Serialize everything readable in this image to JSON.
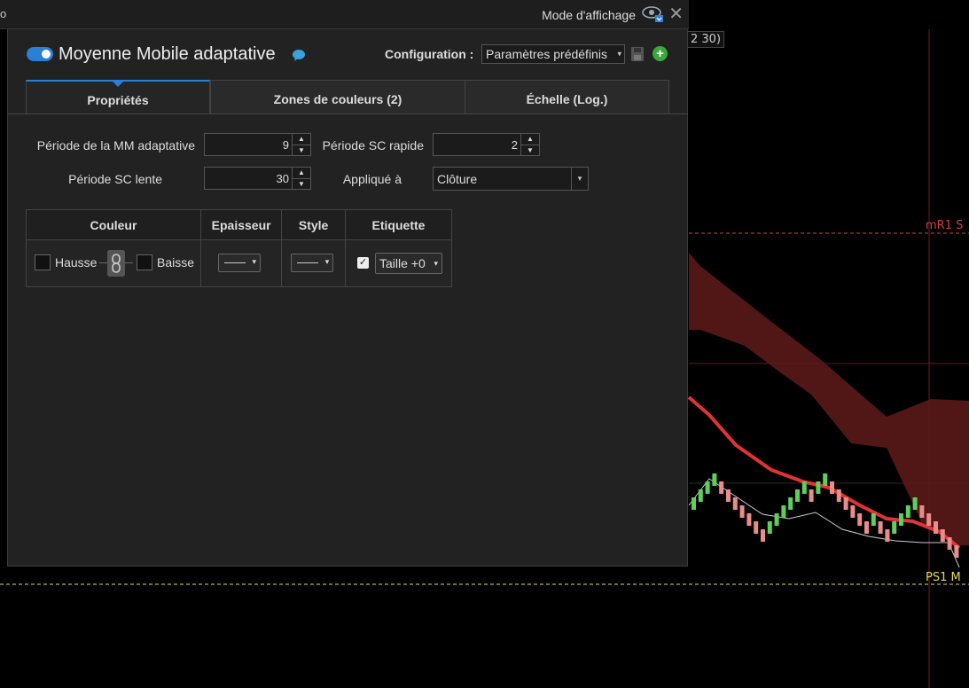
{
  "topbar": {
    "left_text": "o",
    "mode_label": "Mode d'affichage",
    "eye_icon": "eye-icon",
    "close_icon": "close-icon",
    "close_glyph": "✕"
  },
  "chart": {
    "label_top": "2 30)",
    "label_mr1": "mR1 S",
    "label_ps1": "PS1 M",
    "colors": {
      "up": "#5ccf5c",
      "down": "#e88c8c",
      "ma_line": "#e03333",
      "cloud": "#5a1818",
      "level_mr1": "#d04040",
      "level_ps1": "#e8d85a"
    }
  },
  "dialog": {
    "toggle_icon": "toggle-switch-icon",
    "title": "Moyenne Mobile adaptative",
    "config_label": "Configuration :",
    "preset_value": "Paramètres prédéfinis",
    "save_icon": "floppy-disk-icon",
    "add_icon": "plus-circle-icon",
    "add_glyph": "+",
    "accent": "#2b7fd6",
    "tabs": [
      {
        "label": "Propriétés",
        "active": true
      },
      {
        "label": "Zones de couleurs (2)",
        "active": false
      },
      {
        "label": "Échelle (Log.)",
        "active": false
      }
    ],
    "fields": {
      "ama_period_label": "Période de la MM adaptative",
      "ama_period_value": "9",
      "fast_sc_label": "Période SC rapide",
      "fast_sc_value": "2",
      "slow_sc_label": "Période SC lente",
      "slow_sc_value": "30",
      "applied_label": "Appliqué à",
      "applied_value": "Clôture"
    },
    "table": {
      "headers": [
        "Couleur",
        "Epaisseur",
        "Style",
        "Etiquette"
      ],
      "rise_label": "Hausse",
      "fall_label": "Baisse",
      "link_icon": "chain-link-icon",
      "label_checked": true,
      "check_glyph": "✓",
      "size_value": "Taille +0"
    },
    "chevron": "▾",
    "spin_up": "▲",
    "spin_down": "▼"
  }
}
